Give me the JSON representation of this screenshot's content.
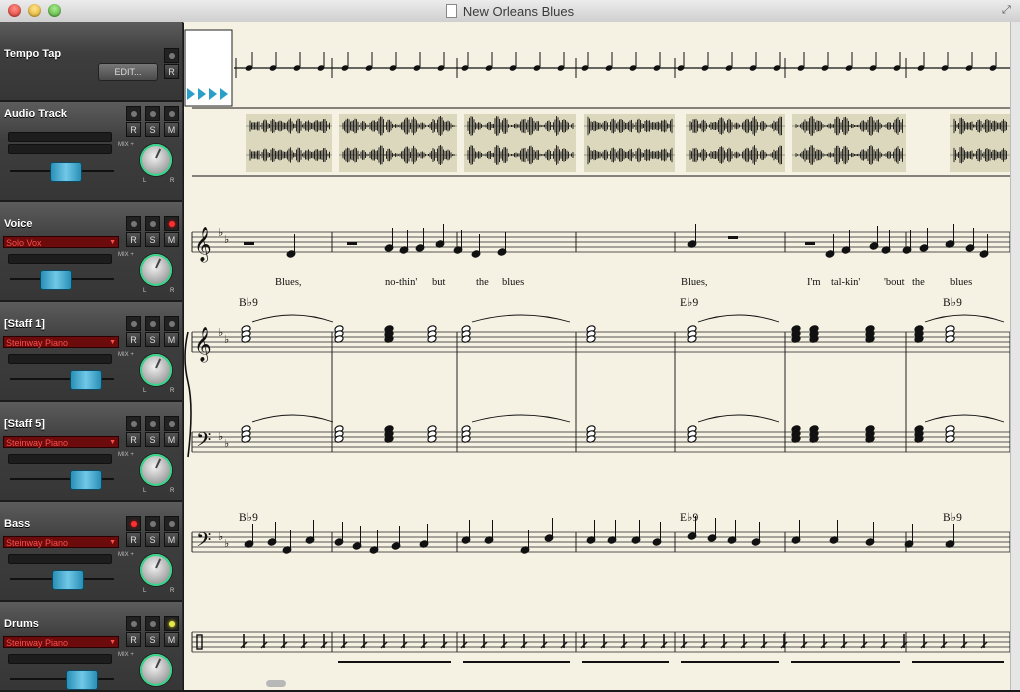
{
  "window": {
    "title": "New Orleans Blues"
  },
  "tracks": [
    {
      "name": "Tempo Tap",
      "button": "EDIT...",
      "record": "R"
    },
    {
      "name": "Audio Track",
      "r": "R",
      "s": "S",
      "m": "M",
      "mix": "MIX +",
      "l": "L",
      "rr": "R"
    },
    {
      "name": "Voice",
      "instrument": "Solo Vox",
      "r": "R",
      "s": "S",
      "m": "M",
      "mix": "MIX +",
      "l": "L",
      "rr": "R"
    },
    {
      "name": "[Staff 1]",
      "instrument": "Steinway Piano",
      "r": "R",
      "s": "S",
      "m": "M",
      "mix": "MIX +",
      "l": "L",
      "rr": "R"
    },
    {
      "name": "[Staff 5]",
      "instrument": "Steinway Piano",
      "r": "R",
      "s": "S",
      "m": "M",
      "mix": "MIX +",
      "l": "L",
      "rr": "R"
    },
    {
      "name": "Bass",
      "instrument": "Steinway Piano",
      "r": "R",
      "s": "S",
      "m": "M",
      "mix": "MIX +",
      "l": "L",
      "rr": "R"
    },
    {
      "name": "Drums",
      "instrument": "Steinway Piano",
      "r": "R",
      "s": "S",
      "m": "M",
      "mix": "MIX +"
    }
  ],
  "score": {
    "lyrics": [
      "Blues,",
      "no-thin'",
      "but",
      "the",
      "blues",
      "Blues,",
      "I'm",
      "tal-kin'",
      "'bout",
      "the",
      "blues"
    ],
    "chords": [
      "B♭9",
      "E♭9",
      "B♭9"
    ],
    "colors": {
      "paper": "#f6f2e3",
      "waveform_bg": "#dcd8bd",
      "play_marker": "#2aa0c8"
    }
  }
}
